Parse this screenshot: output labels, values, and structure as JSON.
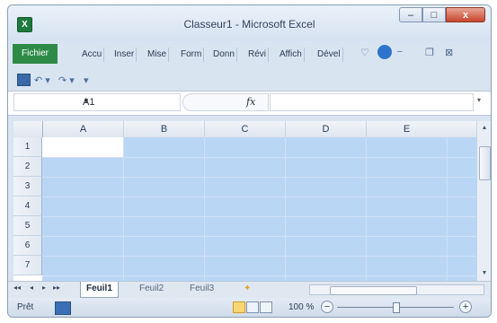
{
  "window": {
    "title": "Classeur1 - Microsoft Excel",
    "app_icon_glyph": "X",
    "controls": {
      "minimize": "–",
      "maximize": "□",
      "close": "x"
    }
  },
  "ribbon": {
    "file_tab": "Fichier",
    "tabs": [
      "Accu",
      "Inser",
      "Mise",
      "Form",
      "Donn",
      "Révi",
      "Affich",
      "Dével"
    ]
  },
  "quick_access": {
    "save": "save-icon",
    "undo": "↶ ▾",
    "redo": "↷ ▾",
    "customize": "▾"
  },
  "formula_bar": {
    "name_box": "A1",
    "fx": "fx",
    "formula": ""
  },
  "grid": {
    "columns": [
      "A",
      "B",
      "C",
      "D",
      "E"
    ],
    "rows": [
      "1",
      "2",
      "3",
      "4",
      "5",
      "6",
      "7"
    ]
  },
  "sheets": {
    "nav": [
      "◂◂",
      "◂",
      "▸",
      "▸▸"
    ],
    "tabs": [
      "Feuil1",
      "Feuil2",
      "Feuil3"
    ],
    "active": "Feuil1"
  },
  "status": {
    "text": "Prêt",
    "zoom": "100 %",
    "zoom_minus": "−",
    "zoom_plus": "+"
  }
}
